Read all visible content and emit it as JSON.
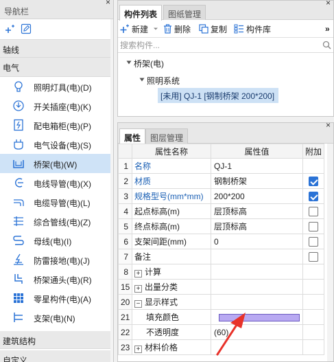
{
  "nav": {
    "title": "导航栏",
    "close_glyph": "×",
    "tools": [
      {
        "icon": "new-item-sparkle-icon"
      },
      {
        "icon": "edit-pencil-icon"
      }
    ],
    "categories": {
      "line": "轴线",
      "electrical": "电气",
      "building": "建筑结构",
      "custom": "自定义"
    },
    "items": [
      {
        "label": "照明灯具(电)(D)",
        "icon": "bulb-icon",
        "selected": false
      },
      {
        "label": "开关插座(电)(K)",
        "icon": "switch-icon",
        "selected": false
      },
      {
        "label": "配电箱柜(电)(P)",
        "icon": "distribution-box-icon",
        "selected": false
      },
      {
        "label": "电气设备(电)(S)",
        "icon": "electrical-device-icon",
        "selected": false
      },
      {
        "label": "桥架(电)(W)",
        "icon": "cable-tray-icon",
        "selected": true
      },
      {
        "label": "电线导管(电)(X)",
        "icon": "wire-conduit-icon",
        "selected": false
      },
      {
        "label": "电缆导管(电)(L)",
        "icon": "cable-conduit-icon",
        "selected": false
      },
      {
        "label": "综合管线(电)(Z)",
        "icon": "combined-pipeline-icon",
        "selected": false
      },
      {
        "label": "母线(电)(I)",
        "icon": "busbar-icon",
        "selected": false
      },
      {
        "label": "防雷接地(电)(J)",
        "icon": "lightning-ground-icon",
        "selected": false
      },
      {
        "label": "桥架通头(电)(R)",
        "icon": "tray-fitting-icon",
        "selected": false
      },
      {
        "label": "零星构件(电)(A)",
        "icon": "misc-component-icon",
        "selected": false
      },
      {
        "label": "支架(电)(N)",
        "icon": "bracket-icon",
        "selected": false
      }
    ]
  },
  "component_panel": {
    "close_glyph": "×",
    "tabs": [
      "构件列表",
      "图纸管理"
    ],
    "active_tab": "构件列表",
    "toolbar": {
      "new": "新建",
      "delete": "删除",
      "copy": "复制",
      "library": "构件库",
      "more": "»"
    },
    "search_placeholder": "搜索构件...",
    "tree": {
      "root": "桥架(电)",
      "child": "照明系统",
      "leaf": "[未用] QJ-1 [钢制桥架 200*200]"
    }
  },
  "property_panel": {
    "close_glyph": "×",
    "tabs": [
      "属性",
      "图层管理"
    ],
    "active_tab": "属性",
    "columns": [
      "属性名称",
      "属性值",
      "附加"
    ],
    "rows": [
      {
        "num": "1",
        "name": "名称",
        "value": "QJ-1",
        "link": true,
        "checkbox": null
      },
      {
        "num": "2",
        "name": "材质",
        "value": "钢制桥架",
        "link": true,
        "checkbox": true
      },
      {
        "num": "3",
        "name": "规格型号(mm*mm)",
        "value": "200*200",
        "link": true,
        "checkbox": true
      },
      {
        "num": "4",
        "name": "起点标高(m)",
        "value": "层顶标高",
        "link": false,
        "checkbox": false
      },
      {
        "num": "5",
        "name": "终点标高(m)",
        "value": "层顶标高",
        "link": false,
        "checkbox": false
      },
      {
        "num": "6",
        "name": "支架间距(mm)",
        "value": "0",
        "link": false,
        "checkbox": false
      },
      {
        "num": "7",
        "name": "备注",
        "value": "",
        "link": false,
        "checkbox": false
      },
      {
        "num": "8",
        "name": "计算",
        "value": "",
        "link": false,
        "checkbox": null,
        "expander": "+"
      },
      {
        "num": "15",
        "name": "出量分类",
        "value": "",
        "link": false,
        "checkbox": null,
        "expander": "+"
      },
      {
        "num": "20",
        "name": "显示样式",
        "value": "",
        "link": false,
        "checkbox": null,
        "expander": "−"
      },
      {
        "num": "21",
        "name": "填充颜色",
        "value": "",
        "link": false,
        "checkbox": null,
        "indent": true,
        "swatch": "#b8a9f2"
      },
      {
        "num": "22",
        "name": "不透明度",
        "value": "(60)",
        "link": false,
        "checkbox": null,
        "indent": true
      },
      {
        "num": "23",
        "name": "材料价格",
        "value": "",
        "link": false,
        "checkbox": null,
        "expander": "+"
      }
    ]
  },
  "colors": {
    "link_blue": "#1a5fb4",
    "selection": "#cfe3f7",
    "checkbox_blue": "#2b73d6",
    "fill_swatch": "#b8a9f2",
    "annotation_arrow": "#e8322a"
  }
}
